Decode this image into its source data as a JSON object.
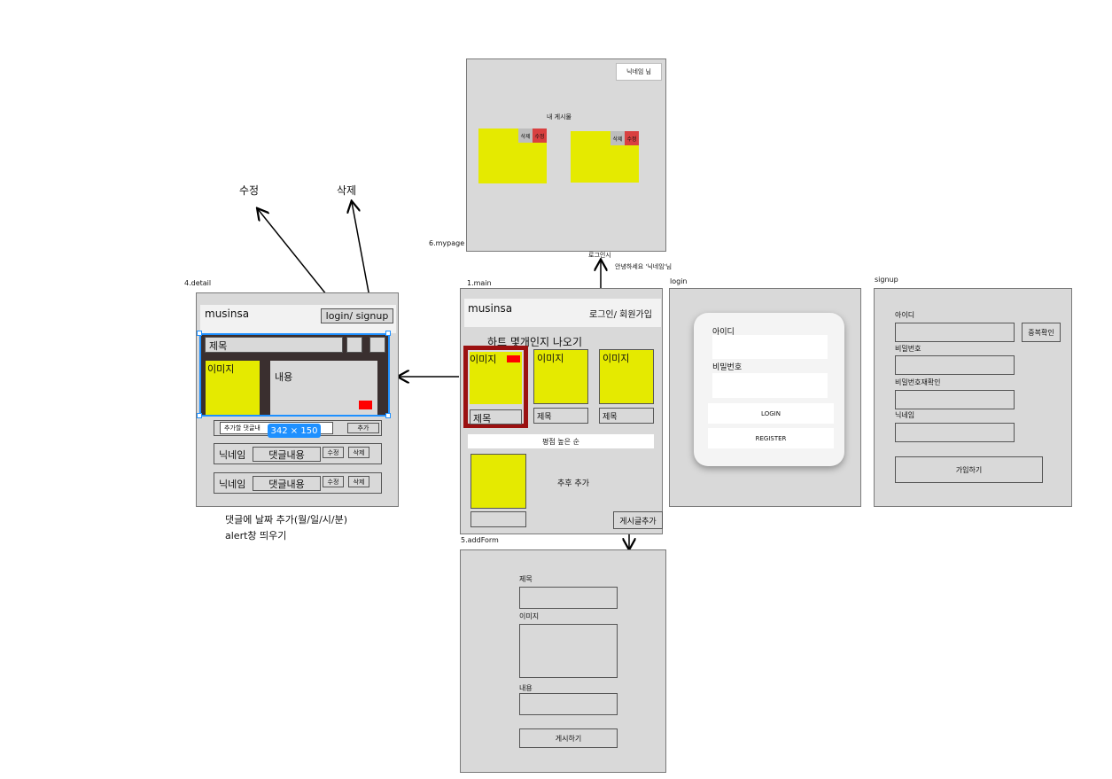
{
  "frames": {
    "mypage": "6.mypage",
    "main": "1.main",
    "detail": "4.detail",
    "login": "login",
    "signup": "signup",
    "addform": "5.addForm"
  },
  "mypage": {
    "nickname_button": "닉네임 님",
    "my_posts_label": "내 게시물",
    "delete_label": "삭제",
    "edit_label": "수정"
  },
  "annotations": {
    "login_when": "로그인시",
    "greeting": "안녕하세요 '닉네임'님",
    "edit": "수정",
    "delete": "삭제",
    "comment_note_1": "댓글에 날짜 추가(월/일/시/분)",
    "comment_note_2": "alert창 띄우기",
    "selection_size": "342 × 150"
  },
  "main": {
    "logo": "musinsa",
    "login_signup": "로그인/ 회원가입",
    "heart_heading": "하트 몇개인지 나오기",
    "image_label": "이미지",
    "title_label": "제목",
    "rating_sort": "평점 높은 순",
    "later_add": "추후 추가",
    "add_post_button": "게시글추가"
  },
  "detail": {
    "logo": "musinsa",
    "login_signup": "login/ signup",
    "title_label": "제목",
    "image_label": "이미지",
    "content_label": "내용",
    "comment_placeholder": "추가할 댓글내",
    "add_button": "추가",
    "comments": [
      {
        "nickname": "닉네임",
        "content": "댓글내용",
        "edit": "수정",
        "delete": "삭제"
      },
      {
        "nickname": "닉네임",
        "content": "댓글내용",
        "edit": "수정",
        "delete": "삭제"
      }
    ]
  },
  "login": {
    "id_label": "아이디",
    "password_label": "비밀번호",
    "login_button": "LOGIN",
    "register_button": "REGISTER"
  },
  "signup": {
    "id_label": "아이디",
    "check_dup_button": "중복확인",
    "password_label": "비밀번호",
    "password_confirm_label": "비밀번호재확인",
    "nickname_label": "닉네임",
    "submit_button": "가입하기"
  },
  "addform": {
    "title_label": "제목",
    "image_label": "이미지",
    "content_label": "내용",
    "post_button": "게시하기"
  },
  "colors": {
    "frame_bg": "#d9d9d9",
    "yellow": "#e5ea00",
    "red": "#ff0000",
    "selection_blue": "#1e90ff",
    "heart_border": "#9b1111",
    "detail_dark": "#3a2f2f"
  }
}
